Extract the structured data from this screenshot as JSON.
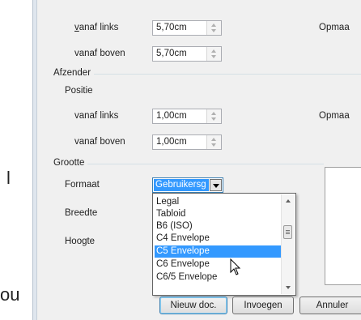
{
  "background": {
    "glyph_top": "l",
    "glyph_bottom": "ou"
  },
  "receiver": {
    "from_left_label": "vanaf links",
    "from_left_value": "5,70cm",
    "from_top_label": "vanaf boven",
    "from_top_value": "5,70cm",
    "options_label": "Opmaa"
  },
  "sender": {
    "group_title": "Afzender",
    "position_label": "Positie",
    "from_left_label": "vanaf links",
    "from_left_value": "1,00cm",
    "from_top_label": "vanaf boven",
    "from_top_value": "1,00cm",
    "options_label": "Opmaa"
  },
  "size": {
    "group_title": "Grootte",
    "format_label": "Formaat",
    "format_value": "Gebruikersg",
    "width_label": "Breedte",
    "height_label": "Hoogte"
  },
  "dropdown": {
    "items": [
      "Legal",
      "Tabloid",
      "B6 (ISO)",
      "C4 Envelope",
      "C5 Envelope",
      "C6 Envelope",
      "C6/5 Envelope"
    ],
    "highlighted": "C5 Envelope"
  },
  "buttons": {
    "new_doc": "Nieuw doc.",
    "insert": "Invoegen",
    "cancel": "Annuler"
  },
  "colors": {
    "selection": "#3399ff",
    "dialog_bg": "#f0f0f0"
  },
  "icons": {
    "cursor": "arrow-cursor-icon",
    "spin": "spin-arrows-icon",
    "dropdown": "chevron-down-icon"
  }
}
